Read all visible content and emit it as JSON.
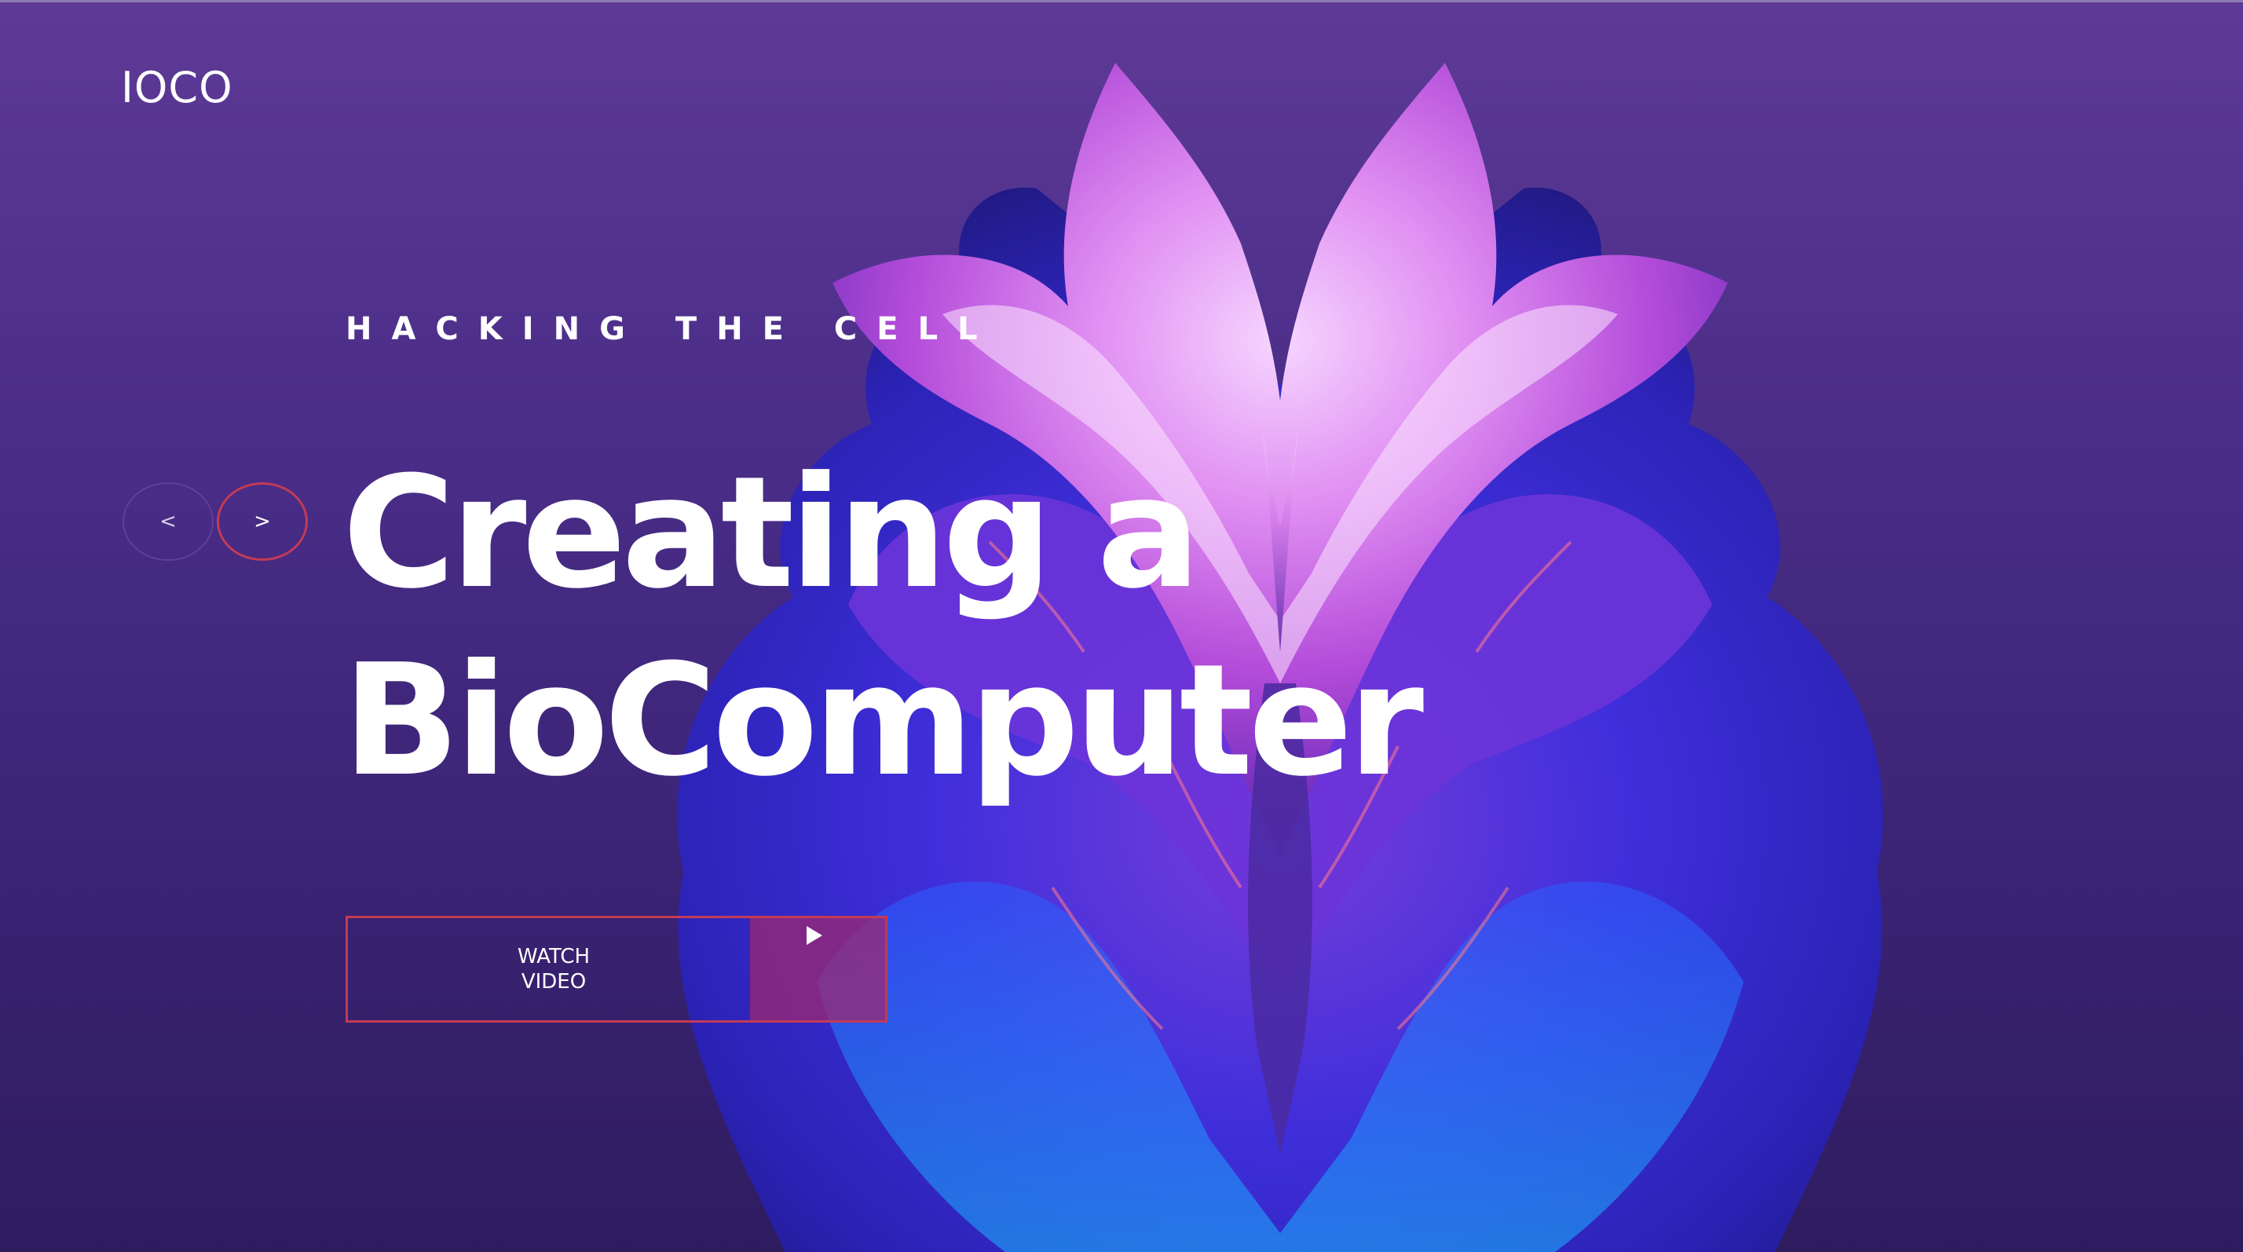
{
  "brand": {
    "logo": "IOCO"
  },
  "hero": {
    "kicker": "HACKING THE CELL",
    "headline_line1": "Creating a",
    "headline_line2": "BioComputer",
    "cta_line1": "WATCH",
    "cta_line2": "VIDEO"
  },
  "slider": {
    "prev_label": "<",
    "next_label": ">"
  },
  "icons": {
    "play": "play-icon",
    "artwork": "symmetric-flower-artwork"
  },
  "colors": {
    "background_top": "#5d3a96",
    "background_bottom": "#2f1c5f",
    "accent": "#c33a57",
    "cta_fill": "#a0286e"
  }
}
